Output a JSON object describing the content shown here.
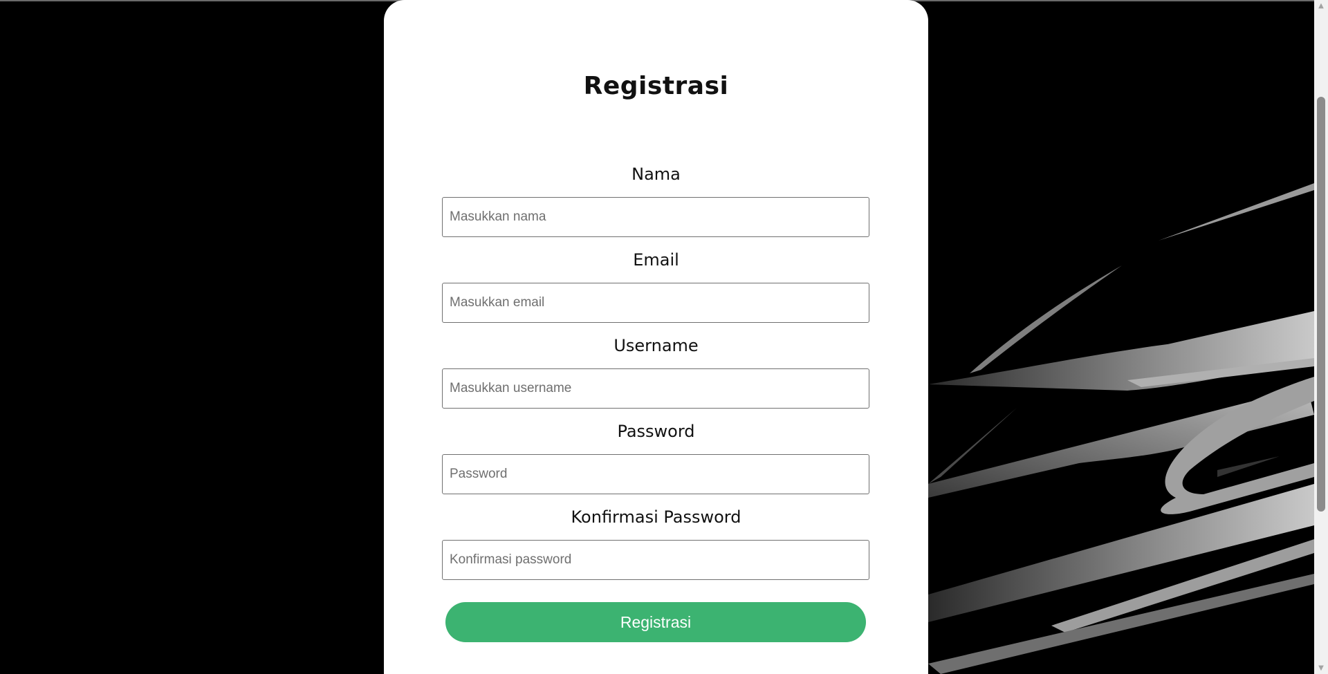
{
  "form": {
    "title": "Registrasi",
    "fields": [
      {
        "label": "Nama",
        "placeholder": "Masukkan nama",
        "type": "text"
      },
      {
        "label": "Email",
        "placeholder": "Masukkan email",
        "type": "email"
      },
      {
        "label": "Username",
        "placeholder": "Masukkan username",
        "type": "text"
      },
      {
        "label": "Password",
        "placeholder": "Password",
        "type": "password"
      },
      {
        "label": "Konfirmasi Password",
        "placeholder": "Konfirmasi password",
        "type": "password"
      }
    ],
    "submit_label": "Registrasi"
  },
  "colors": {
    "page_background": "#000000",
    "card_background": "#ffffff",
    "accent": "#3cb371",
    "streak_highlight": "#c8c8c8"
  },
  "scrollbar": {
    "up_icon": "triangle-up-icon",
    "down_icon": "triangle-down-icon"
  }
}
